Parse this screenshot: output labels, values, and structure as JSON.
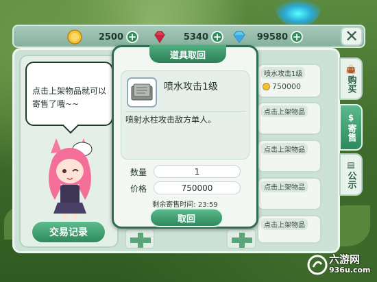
{
  "currency": {
    "gold": {
      "value": "2500",
      "icon": "gold-coin-icon"
    },
    "ruby": {
      "value": "5340",
      "icon": "red-gem-icon"
    },
    "diamond": {
      "value": "99580",
      "icon": "blue-diamond-icon"
    }
  },
  "npc": {
    "speech": "点击上架物品就可以寄售了哦~~",
    "trade_record_label": "交易记录"
  },
  "popup": {
    "title": "道具取回",
    "item_name": "喷水攻击1级",
    "item_desc": "喷射水柱攻击敌方单人。",
    "quantity_label": "数量",
    "quantity_value": "1",
    "price_label": "价格",
    "price_value": "750000",
    "remaining_label": "剩余寄售时间:",
    "remaining_value": "23:59",
    "fetch_label": "取回"
  },
  "listings": [
    {
      "label": "喷水攻击1级",
      "price": "750000"
    },
    {
      "label": "点击上架物品",
      "price": ""
    },
    {
      "label": "点击上架物品",
      "price": ""
    },
    {
      "label": "点击上架物品",
      "price": ""
    },
    {
      "label": "点击上架物品",
      "price": ""
    }
  ],
  "tabs": {
    "buy": "购买",
    "sell": "寄售",
    "notice": "公示"
  },
  "watermark": {
    "name": "六游网",
    "url": "936u.com"
  },
  "colors": {
    "accent": "#2d8a5c",
    "panel": "#cde2d6"
  }
}
